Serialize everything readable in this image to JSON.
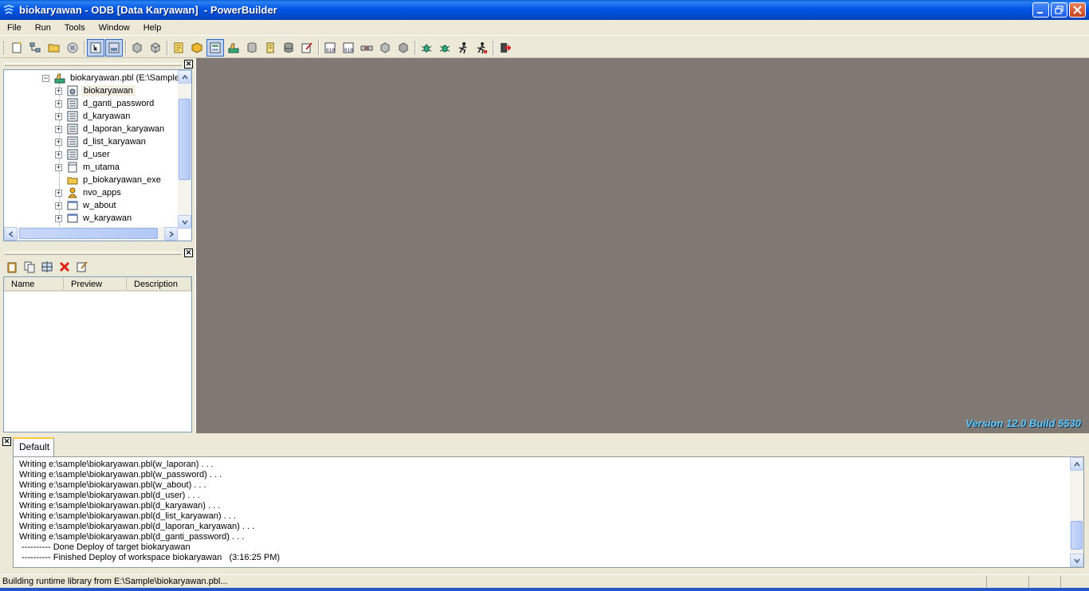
{
  "window": {
    "title": "biokaryawan - ODB [Data Karyawan]  - PowerBuilder"
  },
  "menu": {
    "items": [
      "File",
      "Run",
      "Tools",
      "Window",
      "Help"
    ]
  },
  "toolbar": {
    "buttons": [
      "new-icon",
      "inherit-icon",
      "open-icon",
      "run-window-icon",
      "system-tree-icon",
      "output-window-icon",
      "incremental-build-icon",
      "full-build-icon",
      "edit-source-icon",
      "object-icon",
      "datawindow-painter-icon",
      "library-painter-icon",
      "database-icon",
      "db-profile-icon",
      "db-table-icon",
      "edit-icon",
      "binary-icon",
      "binary2-icon",
      "pipeline-icon",
      "deploy-icon",
      "deploy2-icon",
      "debug-icon",
      "debug2-icon",
      "run-icon",
      "select-and-run-icon",
      "exit-icon"
    ]
  },
  "tree": {
    "root": "biokaryawan.pbl (E:\\Sample",
    "items": [
      {
        "label": "biokaryawan",
        "icon": "application-icon",
        "expander": true,
        "selected": true
      },
      {
        "label": "d_ganti_password",
        "icon": "datawindow-icon",
        "expander": true
      },
      {
        "label": "d_karyawan",
        "icon": "datawindow-icon",
        "expander": true
      },
      {
        "label": "d_laporan_karyawan",
        "icon": "datawindow-icon",
        "expander": true
      },
      {
        "label": "d_list_karyawan",
        "icon": "datawindow-icon",
        "expander": true
      },
      {
        "label": "d_user",
        "icon": "datawindow-icon",
        "expander": true
      },
      {
        "label": "m_utama",
        "icon": "menu-icon",
        "expander": true
      },
      {
        "label": "p_biokaryawan_exe",
        "icon": "project-icon",
        "expander": false
      },
      {
        "label": "nvo_apps",
        "icon": "user-object-icon",
        "expander": true
      },
      {
        "label": "w_about",
        "icon": "window-icon",
        "expander": true
      },
      {
        "label": "w_karyawan",
        "icon": "window-icon",
        "expander": true
      }
    ]
  },
  "library_list": {
    "columns": [
      "Name",
      "Preview",
      "Description"
    ]
  },
  "workspace": {
    "version": "Version 12.0 Build 5530"
  },
  "output": {
    "tab": "Default",
    "lines": [
      "Writing e:\\sample\\biokaryawan.pbl(w_laporan) . . .",
      "Writing e:\\sample\\biokaryawan.pbl(w_password) . . .",
      "Writing e:\\sample\\biokaryawan.pbl(w_about) . . .",
      "Writing e:\\sample\\biokaryawan.pbl(d_user) . . .",
      "Writing e:\\sample\\biokaryawan.pbl(d_karyawan) . . .",
      "Writing e:\\sample\\biokaryawan.pbl(d_list_karyawan) . . .",
      "Writing e:\\sample\\biokaryawan.pbl(d_laporan_karyawan) . . .",
      "Writing e:\\sample\\biokaryawan.pbl(d_ganti_password) . . .",
      " ---------- Done Deploy of target biokaryawan",
      " ---------- Finished Deploy of workspace biokaryawan   (3:16:25 PM)"
    ]
  },
  "status": {
    "text": "Building runtime library from E:\\Sample\\biokaryawan.pbl..."
  }
}
